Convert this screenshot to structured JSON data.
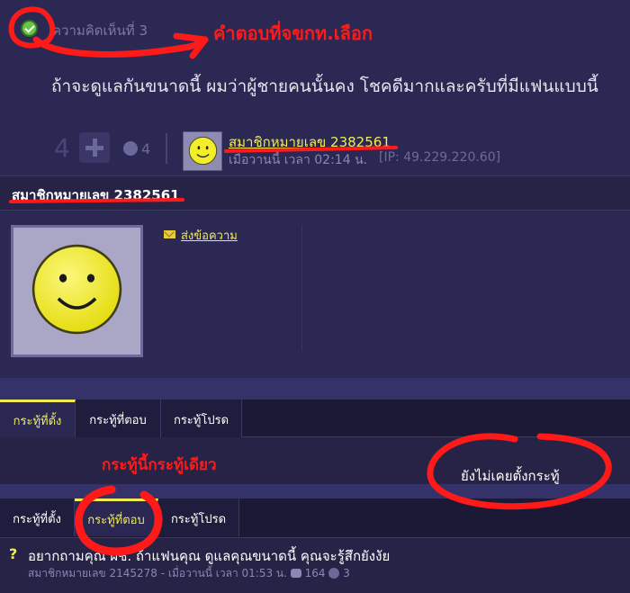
{
  "comment": {
    "number_label": "ความคิดเห็นที่ 3",
    "text": "ถ้าจะดูแลกันขนาดนี้ ผมว่าผู้ชายคนนั้นคง โชคดีมากและครับที่มีแฟนแบบนี้",
    "vote_count": "4",
    "emotion_count": "4",
    "poster_name": "สมาชิกหมายเลข 2382561",
    "post_time": "เมื่อวานนี้ เวลา 02:14 น.",
    "post_ip": "[IP: 49.229.220.60]"
  },
  "annotations": {
    "chosen_answer": "คำตอบที่จขกท.เลือก",
    "only_one_topic": "กระทู้นี้กระทู้เดียว"
  },
  "profile": {
    "name": "สมาชิกหมายเลข 2382561",
    "send_message": "ส่งข้อความ"
  },
  "tabs_top": [
    {
      "label": "กระทู้ที่ตั้ง"
    },
    {
      "label": "กระทู้ที่ตอบ"
    },
    {
      "label": "กระทู้โปรด"
    }
  ],
  "empty_topics": "ยังไม่เคยตั้งกระทู้",
  "tabs_bottom": [
    {
      "label": "กระทู้ที่ตั้ง"
    },
    {
      "label": "กระทู้ที่ตอบ"
    },
    {
      "label": "กระทู้โปรด"
    }
  ],
  "topic": {
    "title": "อยากถามคุณ ผช. ถ้าแฟนคุณ ดูแลคุณขนาดนี้ คุณจะรู้สึกยังงัย",
    "author": "สมาชิกหมายเลข 2145278",
    "time": "เมื่อวานนี้ เวลา 01:53 น.",
    "comment_count": "164",
    "plus_count": "3"
  },
  "colors": {
    "background": "#2b2854",
    "accent": "#f2ec52",
    "markup_red": "#ff1a1a"
  }
}
